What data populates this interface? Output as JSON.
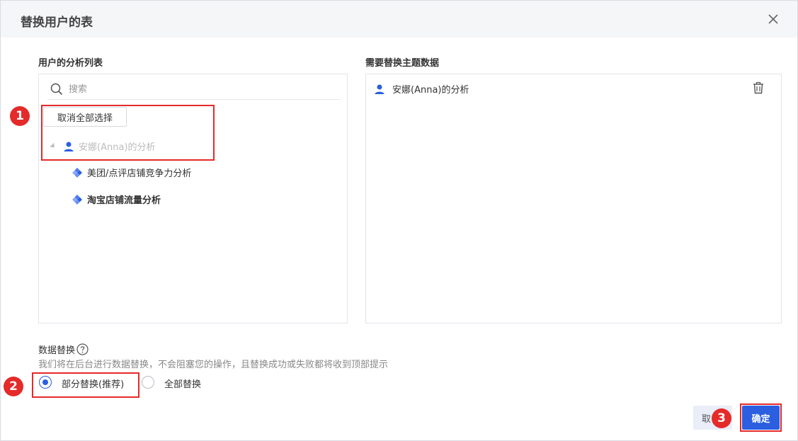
{
  "dialog": {
    "title": "替换用户的表",
    "close_icon": "close-icon"
  },
  "left_panel": {
    "label": "用户的分析列表",
    "search_placeholder": "搜索",
    "deselect_all_label": "取消全部选择",
    "tree": {
      "root": {
        "label": "安娜(Anna)的分析",
        "icon": "user-icon"
      },
      "children": [
        {
          "label": "美团/点评店铺竞争力分析",
          "icon": "diamond-icon",
          "bold": false
        },
        {
          "label": "淘宝店铺流量分析",
          "icon": "diamond-icon",
          "bold": true
        }
      ]
    }
  },
  "right_panel": {
    "label": "需要替换主题数据",
    "items": [
      {
        "label": "安娜(Anna)的分析",
        "icon": "user-icon",
        "action_icon": "trash-icon"
      }
    ]
  },
  "data_replace": {
    "label": "数据替换",
    "help_icon": "help-circle-icon",
    "hint": "我们将在后台进行数据替换，不会阻塞您的操作，且替换成功或失败都将收到顶部提示",
    "options": [
      {
        "label": "部分替换(推荐)",
        "checked": true
      },
      {
        "label": "全部替换",
        "checked": false
      }
    ]
  },
  "footer": {
    "cancel_label": "取",
    "ok_label": "确定"
  },
  "annotations": {
    "badge_1": "1",
    "badge_2": "2",
    "badge_3": "3"
  },
  "colors": {
    "accent": "#2b5fe0",
    "annotation_red": "#e52a2a",
    "header_bg": "#f5f6f8"
  }
}
